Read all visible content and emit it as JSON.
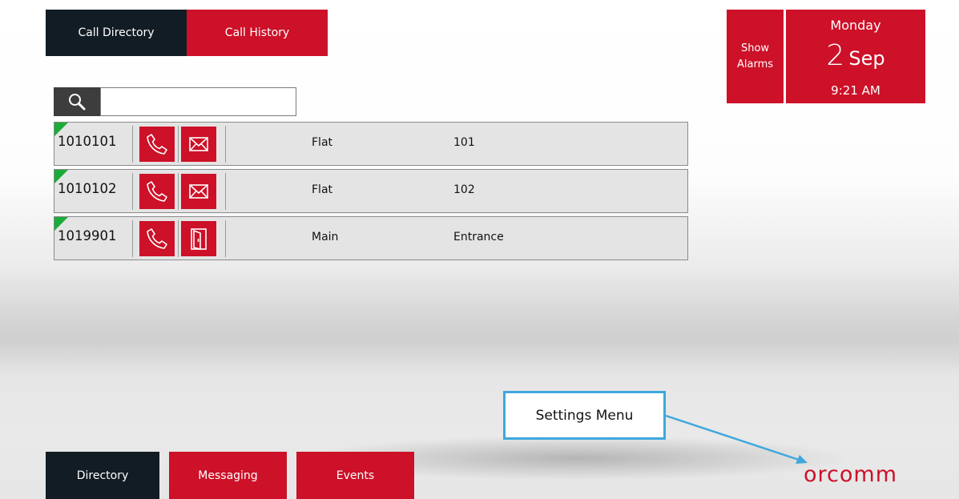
{
  "top_tabs": {
    "directory": "Call Directory",
    "history": "Call History"
  },
  "alarms": {
    "line1": "Show",
    "line2": "Alarms"
  },
  "date_tile": {
    "day": "Monday",
    "date_num": "2",
    "month": "Sep",
    "time": "9:21 AM"
  },
  "search": {
    "value": "",
    "placeholder": ""
  },
  "rows": [
    {
      "number": "1010101",
      "col1": "Flat",
      "col2": "101",
      "action_icon": "envelope-icon"
    },
    {
      "number": "1010102",
      "col1": "Flat",
      "col2": "102",
      "action_icon": "envelope-icon"
    },
    {
      "number": "1019901",
      "col1": "Main",
      "col2": "Entrance",
      "action_icon": "door-icon"
    }
  ],
  "bottom_nav": {
    "directory": "Directory",
    "messaging": "Messaging",
    "events": "Events"
  },
  "callout": {
    "text": "Settings Menu"
  },
  "logo": {
    "text": "orcomm"
  },
  "colors": {
    "accent_red": "#cc1128",
    "dark_navy": "#121c24",
    "status_green": "#1bab3a",
    "callout_blue": "#3fa7dc"
  }
}
